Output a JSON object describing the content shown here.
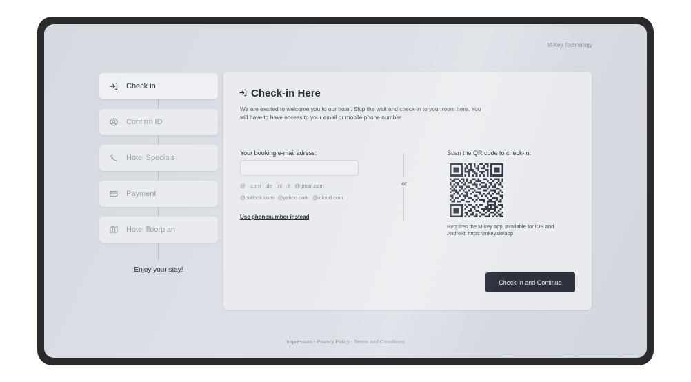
{
  "brand": "M-Key Technology",
  "steps": [
    {
      "label": "Check in",
      "icon": "login-arrow-icon",
      "active": true
    },
    {
      "label": "Confirm ID",
      "icon": "user-circle-icon",
      "active": false
    },
    {
      "label": "Hotel Specials",
      "icon": "bell-icon",
      "active": false
    },
    {
      "label": "Payment",
      "icon": "credit-card-icon",
      "active": false
    },
    {
      "label": "Hotel floorplan",
      "icon": "map-icon",
      "active": false
    }
  ],
  "enjoy": "Enjoy your stay!",
  "card": {
    "title": "Check-in Here",
    "intro": "We are excited to welcome you to our hotel. Skip the wait and check-in to your room here. You will have to have access to your email or mobile phone number.",
    "email_label": "Your booking e-mail adress:",
    "email_value": "",
    "email_placeholder": "",
    "chips_row1": [
      "@",
      ".com",
      ".de",
      ".nl",
      ".fr",
      "@gmail.com"
    ],
    "chips_row2": [
      "@outlook.com",
      "@yahoo.com",
      "@icloud.com"
    ],
    "phone_link": "Use phonenumber instead",
    "or": "or",
    "qr_label": "Scan the QR code to check-in:",
    "qr_note": "Requires the M-key app, available for iOS and Android: https://mkey.de/app",
    "cta": "Check-in and Continue"
  },
  "footer": {
    "links": [
      "Impressum",
      "Privacy Policy",
      "Terms and Conditions"
    ],
    "separator": " - "
  }
}
